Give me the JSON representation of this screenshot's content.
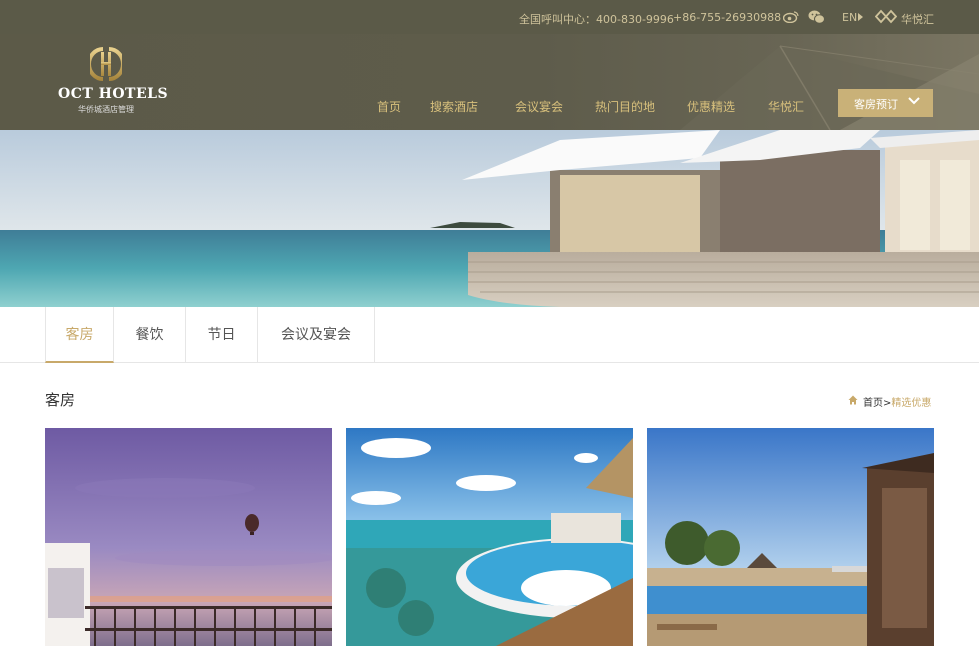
{
  "topbar": {
    "hotline": "全国呼叫中心：400-830-9996",
    "phone2": "+86-755-26930988",
    "lang": "EN",
    "club": "华悦汇"
  },
  "brand": {
    "name": "OCT HOTELS",
    "sub": "华侨城酒店管理"
  },
  "nav": {
    "items": [
      {
        "label": "首页"
      },
      {
        "label": "搜索酒店"
      },
      {
        "label": "会议宴会"
      },
      {
        "label": "热门目的地"
      },
      {
        "label": "优惠精选"
      },
      {
        "label": "华悦汇"
      }
    ],
    "book": "客房预订"
  },
  "tabs": [
    {
      "label": "客房",
      "active": true
    },
    {
      "label": "餐饮",
      "active": false
    },
    {
      "label": "节日",
      "active": false
    },
    {
      "label": "会议及宴会",
      "active": false
    }
  ],
  "section": {
    "title": "客房"
  },
  "breadcrumb": {
    "home": "首页",
    "sep": ">",
    "current": "精选优惠"
  },
  "colors": {
    "gold": "#c8a96a",
    "header": "#5b5a48"
  }
}
